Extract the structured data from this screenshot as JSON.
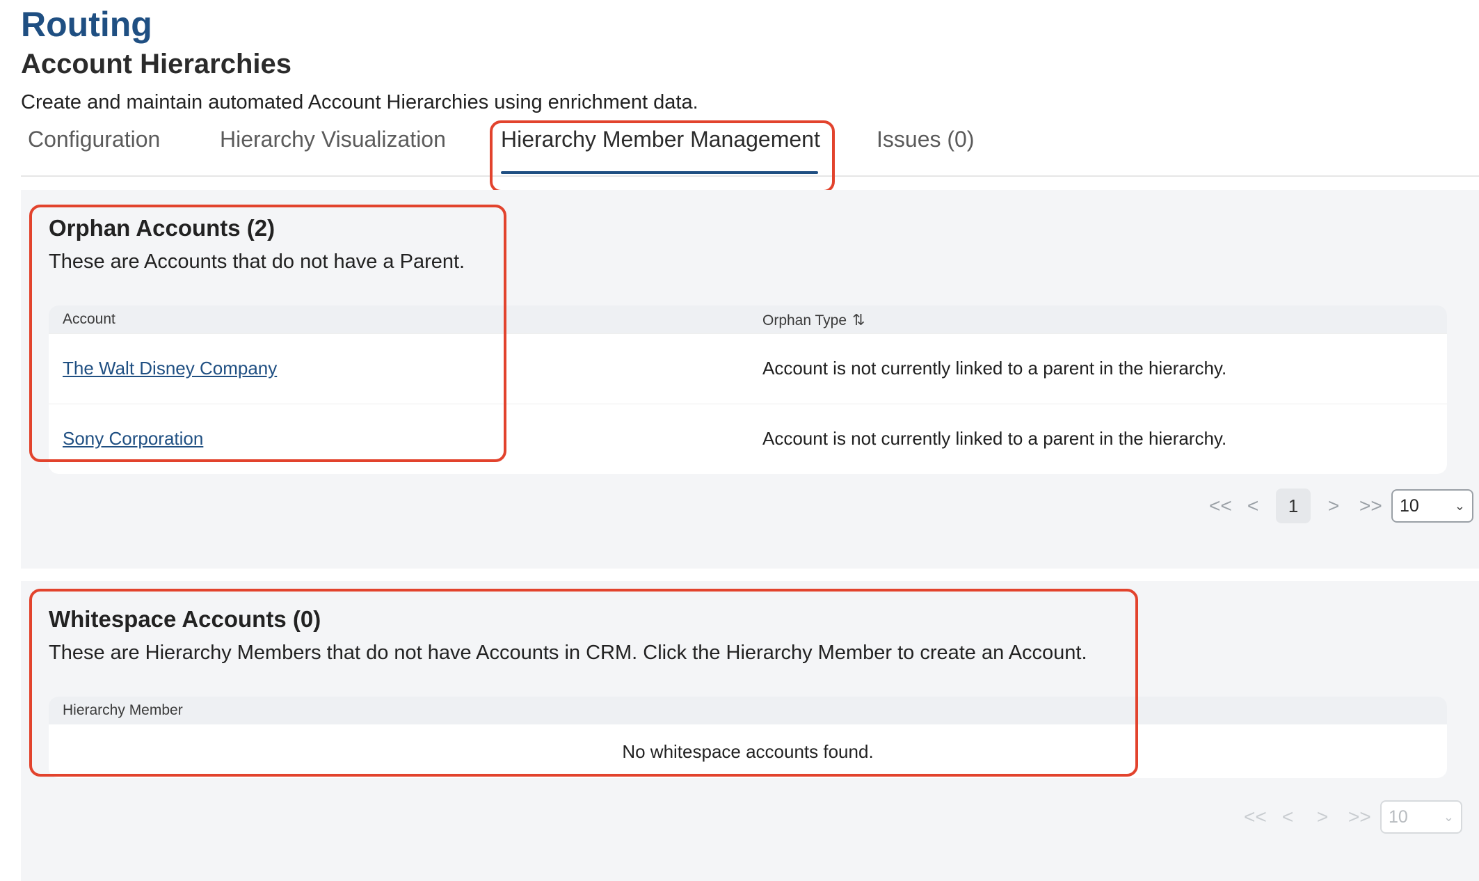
{
  "app": {
    "title": "Routing"
  },
  "page": {
    "title": "Account Hierarchies",
    "description": "Create and maintain automated Account Hierarchies using enrichment data."
  },
  "tabs": [
    {
      "label": "Configuration",
      "active": false
    },
    {
      "label": "Hierarchy Visualization",
      "active": false
    },
    {
      "label": "Hierarchy Member Management",
      "active": true
    },
    {
      "label": "Issues (0)",
      "active": false
    }
  ],
  "orphan": {
    "title": "Orphan Accounts (2)",
    "description": "These are Accounts that do not have a Parent.",
    "columns": [
      "Account",
      "Orphan Type"
    ],
    "sort_icon": "sort-icon",
    "rows": [
      {
        "account": "The Walt Disney Company",
        "type": "Account is not currently linked to a parent in the hierarchy."
      },
      {
        "account": "Sony Corporation",
        "type": "Account is not currently linked to a parent in the hierarchy."
      }
    ],
    "pager": {
      "current_page": "1",
      "page_size": "10"
    }
  },
  "whitespace": {
    "title": "Whitespace Accounts (0)",
    "description": "These are Hierarchy Members that do not have Accounts in CRM. Click the Hierarchy Member to create an Account.",
    "columns": [
      "Hierarchy Member"
    ],
    "empty_message": "No whitespace accounts found.",
    "pager": {
      "page_size": "10"
    }
  },
  "pager_glyphs": {
    "first": "<<",
    "prev": "<",
    "next": ">",
    "last": ">>",
    "chevron": "⌄"
  },
  "colors": {
    "accent": "#1f4f82",
    "highlight": "#e2432d",
    "panel_bg": "#f4f5f7"
  }
}
